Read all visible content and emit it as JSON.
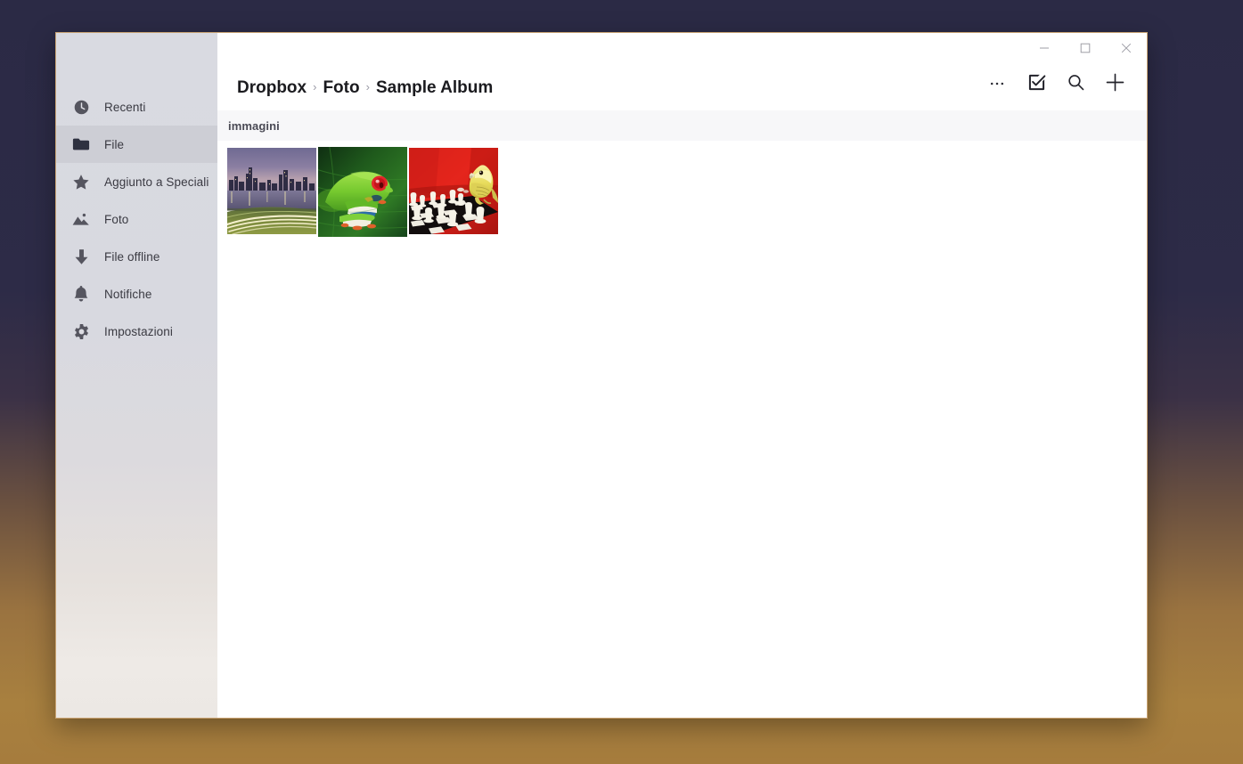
{
  "window": {
    "caption_buttons": [
      {
        "name": "minimize",
        "glyph": "minimize-icon",
        "label": "Riduci a icona"
      },
      {
        "name": "maximize",
        "glyph": "maximize-icon",
        "label": "Ingrandisci"
      },
      {
        "name": "close",
        "glyph": "close-icon",
        "label": "Chiudi"
      }
    ]
  },
  "sidebar": {
    "items": [
      {
        "label": "Recenti",
        "icon": "clock-icon",
        "selected": false
      },
      {
        "label": "File",
        "icon": "folder-icon",
        "selected": true
      },
      {
        "label": "Aggiunto a Speciali",
        "icon": "star-icon",
        "selected": false
      },
      {
        "label": "Foto",
        "icon": "photo-icon",
        "selected": false
      },
      {
        "label": "File offline",
        "icon": "download-icon",
        "selected": false
      },
      {
        "label": "Notifiche",
        "icon": "bell-icon",
        "selected": false
      },
      {
        "label": "Impostazioni",
        "icon": "gear-icon",
        "selected": false
      }
    ]
  },
  "header": {
    "breadcrumb": [
      {
        "label": "Dropbox"
      },
      {
        "label": "Foto"
      },
      {
        "label": "Sample Album"
      }
    ],
    "separator": "›",
    "toolbar": [
      {
        "label": "...",
        "icon": "more-icon",
        "name": "more-options-button"
      },
      {
        "label": "Seleziona",
        "icon": "select-icon",
        "name": "select-button"
      },
      {
        "label": "Cerca",
        "icon": "search-icon",
        "name": "search-button"
      },
      {
        "label": "Aggiungi",
        "icon": "plus-icon",
        "name": "add-button"
      }
    ]
  },
  "main": {
    "section_title": "immagini",
    "thumbnails": [
      {
        "alt": "Skyline di citta al tramonto con scie luminose dell autostrada",
        "id": "photo-city-skyline"
      },
      {
        "alt": "Rana verde dagli occhi rossi su una foglia",
        "id": "photo-tree-frog"
      },
      {
        "alt": "Pappagallino giallo su divano rosso con scacchiera",
        "id": "photo-budgie-chess"
      }
    ]
  },
  "colors": {
    "desktop_top": "#2b2a45",
    "desktop_bottom": "#a67c3d",
    "window_border": "#c8a272",
    "sidebar_top": "#d9dae1",
    "sidebar_bottom": "#ece8e4",
    "selected_row": "#cdced5",
    "icon": "#55555f",
    "text": "#3a3a42",
    "breadcrumb_text": "#1b1b1f",
    "section_band": "#f7f7f9"
  }
}
